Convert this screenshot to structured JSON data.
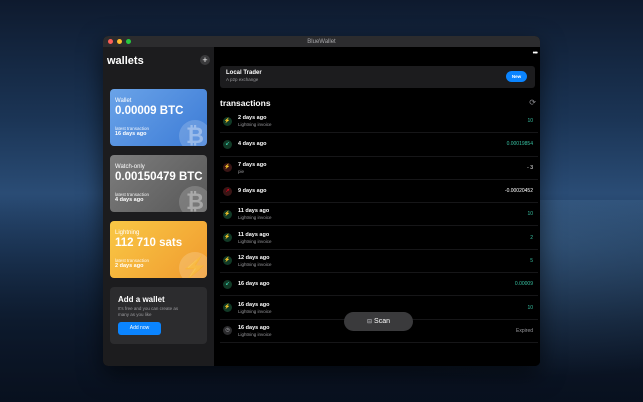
{
  "window": {
    "title": "BlueWallet"
  },
  "sidebar": {
    "title": "wallets",
    "add_icon": "plus-icon",
    "wallets": [
      {
        "label": "Wallet",
        "balance": "0.00009 BTC",
        "latest_label": "latest transaction",
        "latest": "16 days ago",
        "icon": "bitcoin-icon",
        "color": "#4a8be0"
      },
      {
        "label": "Watch-only",
        "balance": "0.00150479 BTC",
        "latest_label": "latest transaction",
        "latest": "4 days ago",
        "icon": "bitcoin-icon",
        "color": "#666666"
      },
      {
        "label": "Lightning",
        "balance": "112 710 sats",
        "latest_label": "latest transaction",
        "latest": "2 days ago",
        "icon": "lightning-icon",
        "color": "#f5b03a"
      }
    ],
    "add_wallet": {
      "title": "Add a wallet",
      "description": "It's free and you can create as many as you like",
      "button": "Add now"
    }
  },
  "main": {
    "more_icon": "ellipsis-icon",
    "local_trader": {
      "title": "Local Trader",
      "subtitle": "A p2p exchange",
      "badge": "New"
    },
    "transactions_title": "transactions",
    "refresh_icon": "refresh-icon",
    "transactions": [
      {
        "date": "2 days ago",
        "memo": "Lightning invoice",
        "amount": "10",
        "kind": "in",
        "icon": "lightning-icon"
      },
      {
        "date": "4 days ago",
        "memo": "",
        "amount": "0.00019854",
        "kind": "in",
        "icon": "arrow-in-icon"
      },
      {
        "date": "7 days ago",
        "memo": "pie",
        "amount": "- 3",
        "kind": "out",
        "icon": "lightning-icon"
      },
      {
        "date": "9 days ago",
        "memo": "",
        "amount": "-0.00020452",
        "kind": "out",
        "icon": "arrow-out-icon"
      },
      {
        "date": "11 days ago",
        "memo": "Lightning invoice",
        "amount": "10",
        "kind": "in",
        "icon": "lightning-icon"
      },
      {
        "date": "11 days ago",
        "memo": "Lightning invoice",
        "amount": "2",
        "kind": "in",
        "icon": "lightning-icon"
      },
      {
        "date": "12 days ago",
        "memo": "Lightning invoice",
        "amount": "5",
        "kind": "in",
        "icon": "lightning-icon"
      },
      {
        "date": "16 days ago",
        "memo": "",
        "amount": "0.00009",
        "kind": "in",
        "icon": "arrow-in-icon"
      },
      {
        "date": "16 days ago",
        "memo": "Lightning invoice",
        "amount": "10",
        "kind": "in",
        "icon": "lightning-icon"
      },
      {
        "date": "16 days ago",
        "memo": "Lightning invoice",
        "amount": "Expired",
        "kind": "exp",
        "icon": "clock-icon"
      }
    ],
    "scan": {
      "label": "Scan",
      "icon": "scan-icon"
    }
  },
  "colors": {
    "accent": "#0a84ff",
    "incoming": "#37c0a1",
    "outgoing": "#d0021b"
  }
}
